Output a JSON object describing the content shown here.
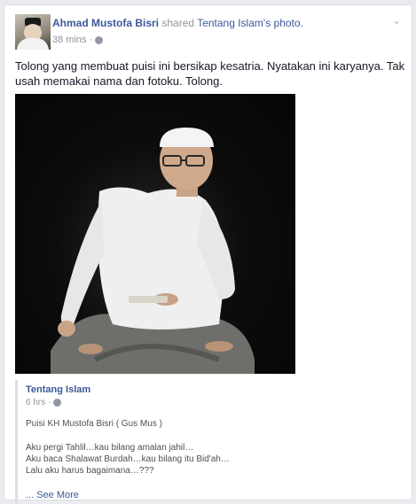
{
  "post": {
    "author": "Ahmad Mustofa Bisri",
    "shared_text": "shared",
    "shared_page": "Tentang Islam",
    "shared_suffix": "'s photo.",
    "time": "38 mins ·",
    "privacy_icon": "globe-icon",
    "text": "Tolong yang membuat puisi ini bersikap kesatria. Nyatakan ini karyanya. Tak usah memakai nama dan fotoku. Tolong.",
    "options_icon": "chevron-down-icon"
  },
  "attachment": {
    "page_name": "Tentang Islam",
    "time": "6 hrs ·",
    "title": "Puisi KH Mustofa Bisri ( Gus Mus )",
    "lines": [
      "Aku pergi Tahlil…kau bilang amalan jahil…",
      "Aku baca Shalawat Burdah…kau bilang itu Bid'ah…",
      "Lalu aku harus bagaimana…???"
    ],
    "see_more": "... See More"
  },
  "colors": {
    "link": "#3b5998",
    "meta": "#90949c",
    "background": "#e9ebee"
  }
}
